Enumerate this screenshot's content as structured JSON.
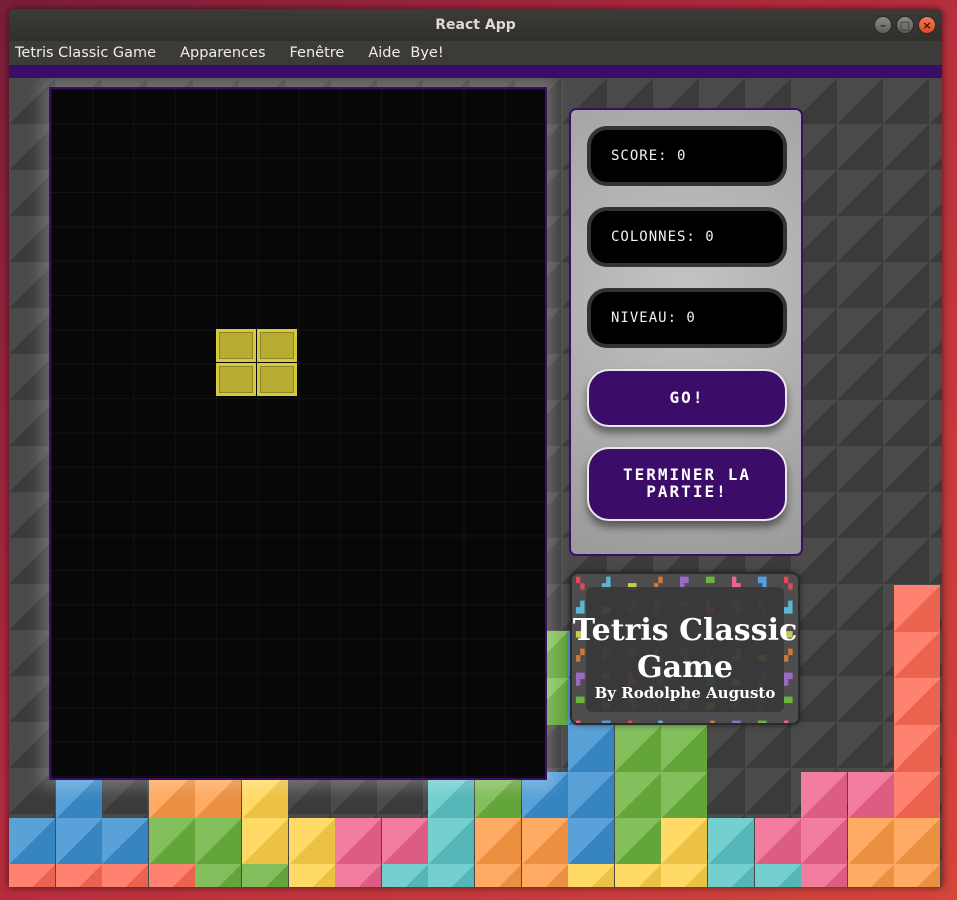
{
  "window": {
    "title": "React App"
  },
  "menu": {
    "items": [
      "Tetris Classic Game",
      "Apparences",
      "Fenêtre",
      "Aide",
      "Bye!"
    ]
  },
  "stats": {
    "score_label": "SCORE: 0",
    "columns_label": "COLONNES: 0",
    "level_label": "NIVEAU: 0"
  },
  "buttons": {
    "go": "GO!",
    "end_line1": "TERMINER LA",
    "end_line2": "PARTIE!"
  },
  "logo": {
    "title_line1": "Tetris Classic",
    "title_line2": "Game",
    "byline": "By Rodolphe Augusto"
  },
  "colors": {
    "accent": "#3b0d68",
    "piece": "#b8ad33",
    "board": "#070707"
  }
}
